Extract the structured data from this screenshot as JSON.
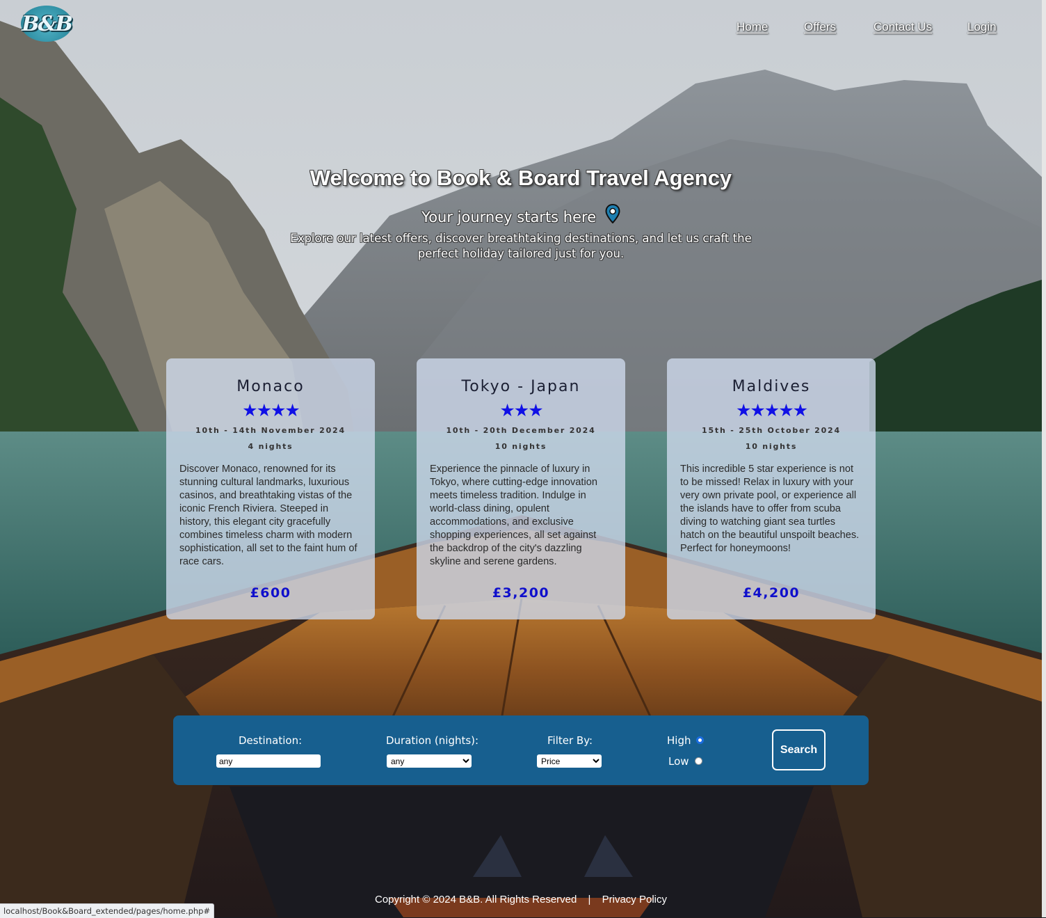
{
  "header": {
    "logo_text": "B&B",
    "nav": [
      {
        "label": "Home"
      },
      {
        "label": "Offers"
      },
      {
        "label": "Contact Us"
      },
      {
        "label": "Login"
      }
    ]
  },
  "hero": {
    "title": "Welcome to Book & Board Travel Agency",
    "subtitle": "Your journey starts here",
    "text": "Explore our latest offers, discover breathtaking destinations, and let us craft the perfect holiday tailored just for you.",
    "subtitle_icon": "location-pin-icon"
  },
  "offers": [
    {
      "name": "Monaco",
      "stars": 4,
      "dates": "10th - 14th November 2024",
      "nights": "4 nights",
      "description": "Discover Monaco, renowned for its stunning cultural landmarks, luxurious casinos, and breathtaking vistas of the iconic French Riviera. Steeped in history, this elegant city gracefully combines timeless charm with modern sophistication, all set to the faint hum of race cars.",
      "price": "£600"
    },
    {
      "name": "Tokyo - Japan",
      "stars": 3,
      "dates": "10th - 20th December 2024",
      "nights": "10 nights",
      "description": "Experience the pinnacle of luxury in Tokyo, where cutting-edge innovation meets timeless tradition. Indulge in world-class dining, opulent accommodations, and exclusive shopping experiences, all set against the backdrop of the city's dazzling skyline and serene gardens.",
      "price": "£3,200"
    },
    {
      "name": "Maldives",
      "stars": 5,
      "dates": "15th - 25th October 2024",
      "nights": "10 nights",
      "description": "This incredible 5 star experience is not to be missed! Relax in luxury with your very own private pool, or experience all the islands have to offer from scuba diving to watching giant sea turtles hatch on the beautiful unspoilt beaches. Perfect for honeymoons!",
      "price": "£4,200"
    }
  ],
  "search": {
    "destination_label": "Destination:",
    "destination_value": "any",
    "duration_label": "Duration (nights):",
    "duration_value": "any",
    "filter_label": "Filter By:",
    "filter_value": "Price",
    "high_label": "High",
    "low_label": "Low",
    "selected_order": "High",
    "button_label": "Search"
  },
  "footer": {
    "copyright": "Copyright © 2024 B&B. All Rights Reserved",
    "separator": "|",
    "privacy": "Privacy Policy"
  },
  "status_bar_url": "localhost/Book&Board_extended/pages/home.php#",
  "colors": {
    "star": "#1010e6",
    "price": "#0f0fcc",
    "search_bar": "#175f8f",
    "card_bg": "#cdd8eb"
  }
}
